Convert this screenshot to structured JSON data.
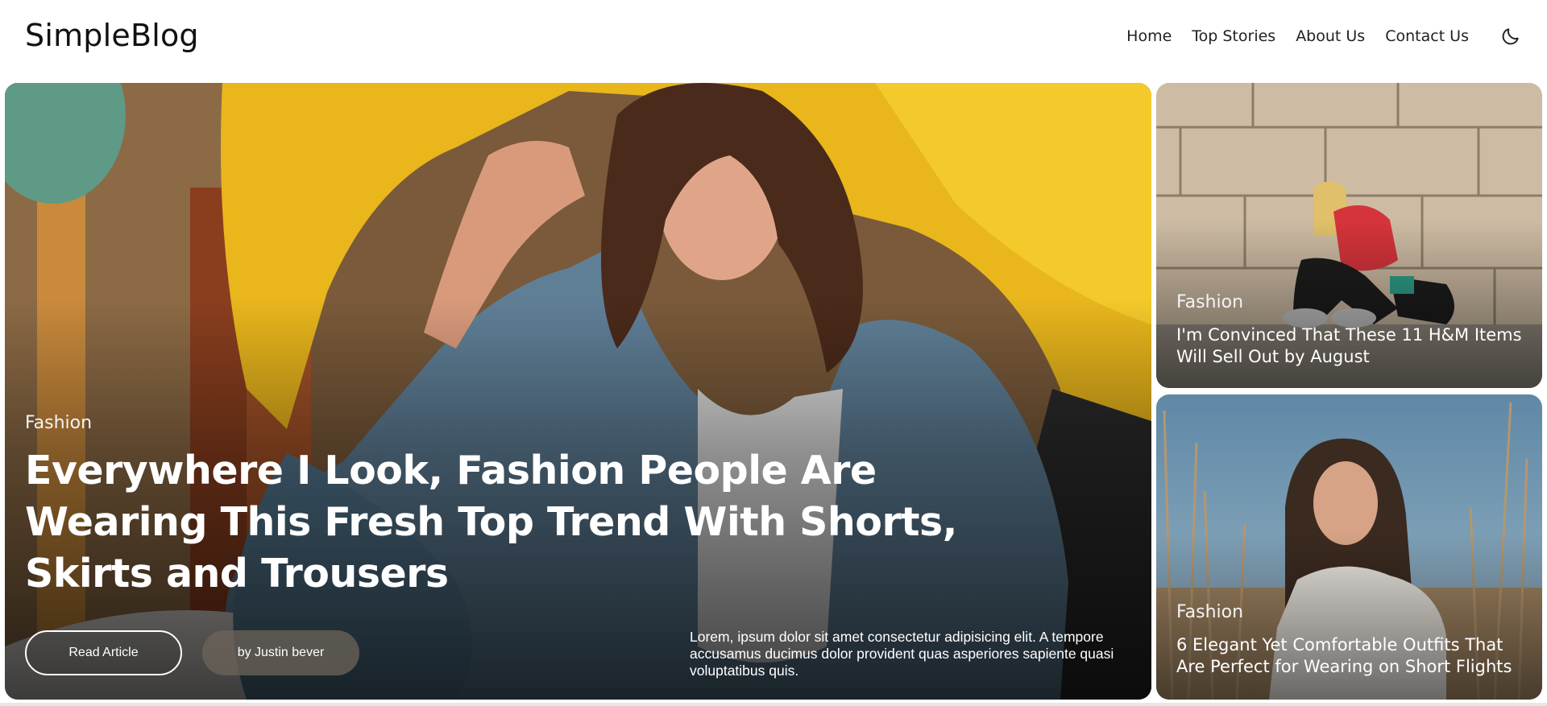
{
  "header": {
    "logo": "SimpleBlog",
    "nav": [
      "Home",
      "Top Stories",
      "About Us",
      "Contact Us"
    ],
    "theme_toggle_icon": "moon-icon"
  },
  "hero": {
    "category": "Fashion",
    "title": "Everywhere I Look, Fashion People Are Wearing This Fresh Top Trend With Shorts, Skirts and Trousers",
    "read_button": "Read Article",
    "author_button": "by Justin bever",
    "excerpt": "Lorem, ipsum dolor sit amet consectetur adipisicing elit. A tempore accusamus ducimus dolor provident quas asperiores sapiente quasi voluptatibus quis."
  },
  "side_articles": [
    {
      "category": "Fashion",
      "title": "I'm Convinced That These 11 H&M Items Will Sell Out by August"
    },
    {
      "category": "Fashion",
      "title": "6 Elegant Yet Comfortable Outfits That Are Perfect for Wearing on Short Flights"
    }
  ],
  "colors": {
    "hero_yellow": "#e9b61c",
    "denim": "#5f7f97",
    "stone": "#cdbba3",
    "sky": "#6f93ad"
  }
}
